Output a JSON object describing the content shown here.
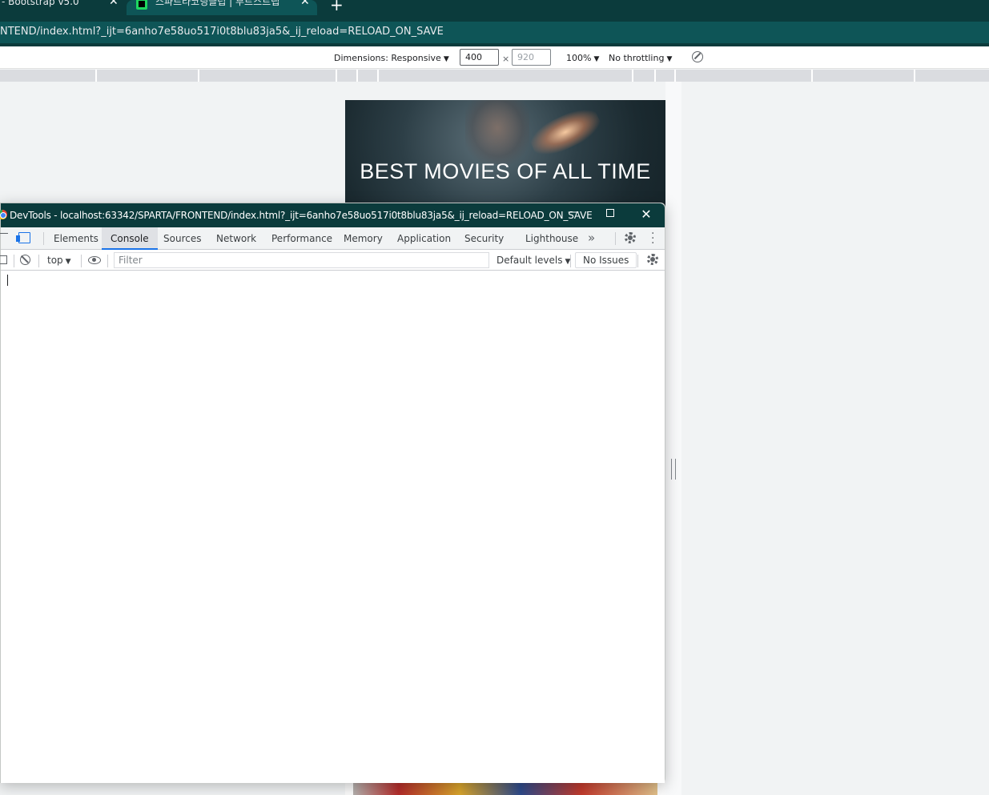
{
  "browser": {
    "tabs": [
      {
        "title": "- Bootstrap v5.0",
        "close": "✕"
      },
      {
        "title": "스파르타코딩클럽 | 부트스트랩",
        "close": "✕"
      }
    ],
    "new_tab": "+",
    "url": "NTEND/index.html?_ijt=6anho7e58uo517i0t8blu83ja5&_ij_reload=RELOAD_ON_SAVE"
  },
  "device_toolbar": {
    "dimensions_label": "Dimensions: Responsive",
    "width": "400",
    "height": "920",
    "times": "×",
    "zoom": "100%",
    "throttling": "No throttling",
    "caret": "▼"
  },
  "page": {
    "hero_title": "BEST MOVIES OF ALL TIME"
  },
  "devtools": {
    "window_title": "DevTools - localhost:63342/SPARTA/FRONTEND/index.html?_ijt=6anho7e58uo517i0t8blu83ja5&_ij_reload=RELOAD_ON_SAVE",
    "minimize": "—",
    "close": "✕",
    "tabs": [
      "Elements",
      "Console",
      "Sources",
      "Network",
      "Performance",
      "Memory",
      "Application",
      "Security",
      "Lighthouse"
    ],
    "more_tabs": "»",
    "active_tab": "Console",
    "console": {
      "context": "top",
      "filter_placeholder": "Filter",
      "levels": "Default levels",
      "issues": "No Issues"
    }
  }
}
